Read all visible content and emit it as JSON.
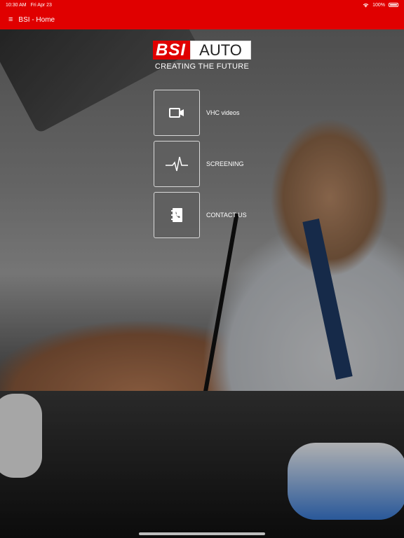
{
  "status_bar": {
    "time": "10:30 AM",
    "date": "Fri Apr 23",
    "battery": "100%"
  },
  "nav": {
    "title": "BSI - Home"
  },
  "logo": {
    "part1": "BSI",
    "part2": "AUTO",
    "tagline": "CREATING THE FUTURE"
  },
  "menu": [
    {
      "label": "VHC videos",
      "icon": "video-camera-icon"
    },
    {
      "label": "SCREENING",
      "icon": "heartbeat-icon"
    },
    {
      "label": "CONTACT US",
      "icon": "contact-book-icon"
    }
  ],
  "colors": {
    "brand_red": "#e00000",
    "tile_bg": "#5f5f5f",
    "tile_border": "#d9d9d9"
  }
}
